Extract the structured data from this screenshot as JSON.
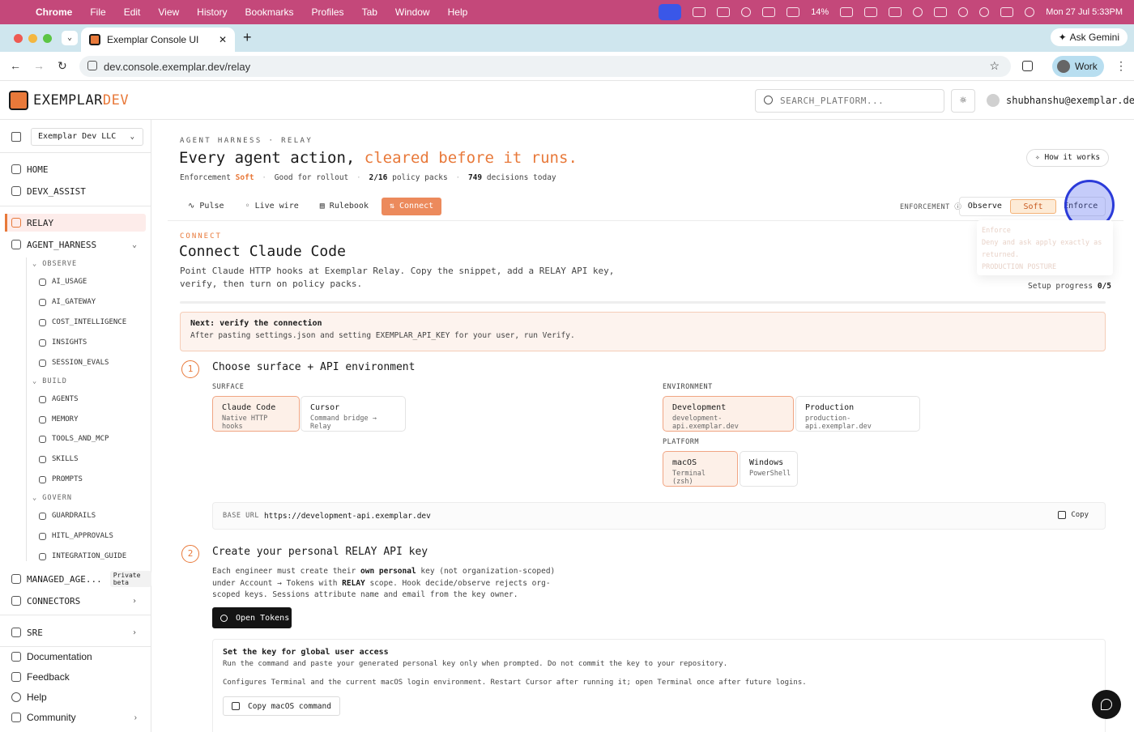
{
  "menubar": {
    "app": "Chrome",
    "items": [
      "File",
      "Edit",
      "View",
      "History",
      "Bookmarks",
      "Profiles",
      "Tab",
      "Window",
      "Help"
    ],
    "battery": "14%",
    "datetime": "Mon 27 Jul  5:33PM"
  },
  "browser": {
    "tab_title": "Exemplar Console UI",
    "ask_gemini": "Ask Gemini",
    "url": "dev.console.exemplar.dev/relay",
    "profile": "Work"
  },
  "header": {
    "brand_main": "EXEMPLAR",
    "brand_accent": "DEV",
    "search_placeholder": "SEARCH_PLATFORM...",
    "user_email": "shubhanshu@exemplar.dev"
  },
  "sidebar": {
    "org": "Exemplar Dev LLC",
    "home": "HOME",
    "devx": "DEVX_ASSIST",
    "relay": "RELAY",
    "agent_harness": "AGENT_HARNESS",
    "sections": {
      "observe": "OBSERVE",
      "build": "BUILD",
      "govern": "GOVERN"
    },
    "observe_items": [
      "AI_USAGE",
      "AI_GATEWAY",
      "COST_INTELLIGENCE",
      "INSIGHTS",
      "SESSION_EVALS"
    ],
    "build_items": [
      "AGENTS",
      "MEMORY",
      "TOOLS_AND_MCP",
      "SKILLS",
      "PROMPTS"
    ],
    "govern_items": [
      "GUARDRAILS",
      "HITL_APPROVALS",
      "INTEGRATION_GUIDE"
    ],
    "managed": "MANAGED_AGE...",
    "managed_badge": "Private beta",
    "connectors": "CONNECTORS",
    "sre": "SRE",
    "footer": [
      "Documentation",
      "Feedback",
      "Help",
      "Community"
    ]
  },
  "page": {
    "eyebrow": "AGENT HARNESS · RELAY",
    "title_main": "Every agent action, ",
    "title_accent": "cleared before it runs.",
    "meta": {
      "enforcement_label": "Enforcement",
      "enforcement_value": "Soft",
      "rollout": "Good for rollout",
      "packs_value": "2/16",
      "packs_label": "policy packs",
      "decisions_value": "749",
      "decisions_label": "decisions today"
    },
    "how_it_works": "How it works",
    "tabs": [
      "Pulse",
      "Live wire",
      "Rulebook",
      "Connect"
    ],
    "enforcement_ctrl_label": "ENFORCEMENT",
    "enforcement_options": [
      "Observe",
      "Soft",
      "Enforce"
    ],
    "tooltip": {
      "title": "Enforce",
      "desc": "Deny and ask apply exactly as returned.",
      "posture": "PRODUCTION POSTURE"
    }
  },
  "connect": {
    "kicker": "CONNECT",
    "title": "Connect Claude Code",
    "lede": "Point Claude HTTP hooks at Exemplar Relay. Copy the snippet, add a RELAY API key, verify, then turn on policy packs.",
    "progress_label": "Setup progress",
    "progress_value": "0/5",
    "progress_fraction": 0,
    "alert_title": "Next: verify the connection",
    "alert_desc": "After pasting settings.json and setting EXEMPLAR_API_KEY for your user, run Verify.",
    "step1": {
      "num": "1",
      "title": "Choose surface + API environment",
      "surface_label": "SURFACE",
      "surfaces": [
        {
          "title": "Claude Code",
          "sub": "Native HTTP hooks"
        },
        {
          "title": "Cursor",
          "sub": "Command bridge → Relay"
        }
      ],
      "env_label": "ENVIRONMENT",
      "envs": [
        {
          "title": "Development",
          "sub": "development-api.exemplar.dev"
        },
        {
          "title": "Production",
          "sub": "production-api.exemplar.dev"
        }
      ],
      "platform_label": "PLATFORM",
      "platforms": [
        {
          "title": "macOS",
          "sub": "Terminal (zsh)"
        },
        {
          "title": "Windows",
          "sub": "PowerShell"
        }
      ],
      "base_url_label": "BASE URL",
      "base_url": "https://development-api.exemplar.dev",
      "copy": "Copy"
    },
    "step2": {
      "num": "2",
      "title": "Create your personal RELAY API key",
      "desc_a": "Each engineer must create their ",
      "desc_b": "own personal",
      "desc_c": " key (not organization-scoped) under Account → Tokens with ",
      "desc_d": "RELAY",
      "desc_e": " scope. Hook decide/observe rejects org-scoped keys. Sessions attribute name and email from the key owner.",
      "open_tokens": "Open Tokens",
      "box_title": "Set the key for global user access",
      "box_desc": "Run the command and paste your generated personal key only when prompted. Do not commit the key to your repository.",
      "box_desc2": "Configures Terminal and the current macOS login environment. Restart Cursor after running it; open Terminal once after future logins.",
      "copy_mac": "Copy macOS command"
    }
  },
  "colors": {
    "accent": "#e8793a",
    "menubar": "#c4487a",
    "cursor_ring": "#2b3bd9"
  }
}
